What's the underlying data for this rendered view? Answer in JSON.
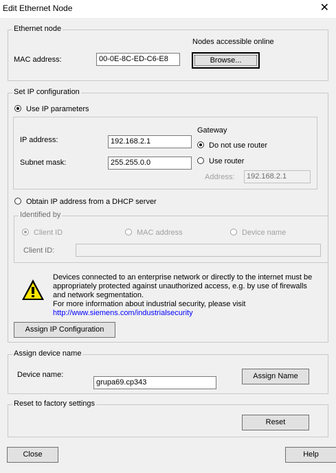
{
  "window": {
    "title": "Edit Ethernet Node",
    "close_glyph": "✕"
  },
  "ethernet_node": {
    "legend": "Ethernet node",
    "mac_label": "MAC address:",
    "mac_value": "00-0E-8C-ED-C6-E8",
    "nodes_online_label": "Nodes accessible online",
    "browse_label": "Browse..."
  },
  "ip_config": {
    "legend": "Set IP configuration",
    "use_ip_label": "Use IP parameters",
    "ip_label": "IP address:",
    "ip_value": "192.168.2.1",
    "subnet_label": "Subnet mask:",
    "subnet_value": "255.255.0.0",
    "gateway_label": "Gateway",
    "no_router_label": "Do not use router",
    "use_router_label": "Use router",
    "router_address_label": "Address:",
    "router_address_value": "192.168.2.1",
    "dhcp_label": "Obtain IP address from a DHCP server",
    "identified_by_label": "Identified by",
    "client_id_option": "Client ID",
    "mac_option": "MAC address",
    "device_name_option": "Device name",
    "client_id_label": "Client ID:",
    "client_id_value": "",
    "warning_lines": [
      "Devices connected to an enterprise network or directly to the internet must be",
      "appropriately protected against unauthorized access, e.g. by use of firewalls",
      "and network segmentation.",
      "For more information about industrial security, please visit"
    ],
    "warning_link": "http://www.siemens.com/industrialsecurity",
    "assign_ip_label": "Assign IP Configuration"
  },
  "device_name_group": {
    "legend": "Assign device name",
    "device_name_label": "Device name:",
    "device_name_value": "grupa69.cp343",
    "assign_name_label": "Assign Name"
  },
  "reset_group": {
    "legend": "Reset to factory settings",
    "reset_label": "Reset"
  },
  "footer": {
    "close_label": "Close",
    "help_label": "Help"
  },
  "colors": {
    "background": "#f0f0f0",
    "link": "#0000ff",
    "warning_yellow": "#ffe600"
  }
}
